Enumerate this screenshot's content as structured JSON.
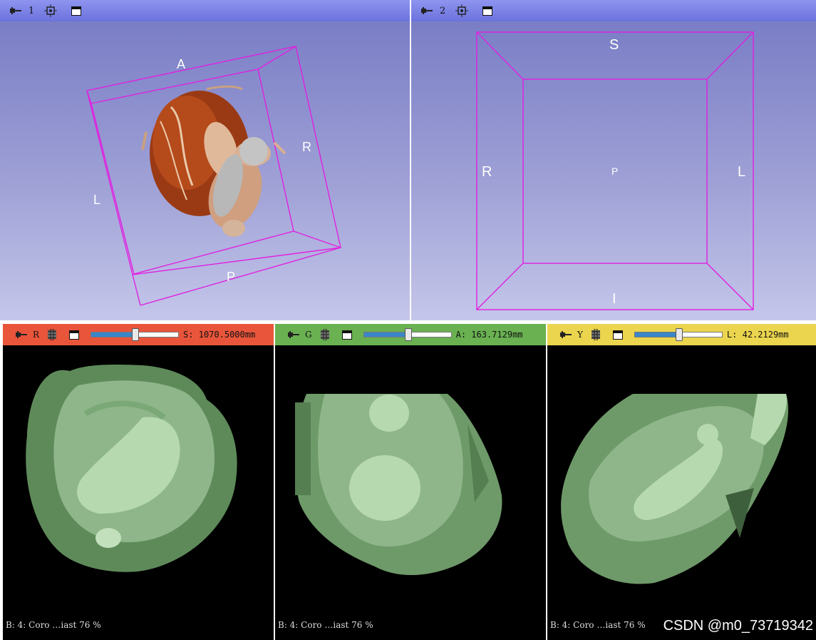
{
  "view1": {
    "number": "1",
    "orientation": {
      "A": "A",
      "R": "R",
      "L": "L",
      "P": "P"
    }
  },
  "view2": {
    "number": "2",
    "orientation": {
      "S": "S",
      "R": "R",
      "L": "L",
      "P": "P",
      "I": "I"
    }
  },
  "slices": [
    {
      "name": "R",
      "color": "#e9553b",
      "slider_fraction": 0.5,
      "value": "S: 1070.5000mm",
      "footer": "B: 4: Coro  …iast 76 %"
    },
    {
      "name": "G",
      "color": "#6ab151",
      "slider_fraction": 0.5,
      "value": "A: 163.7129mm",
      "footer": "B: 4: Coro  …iast 76 %"
    },
    {
      "name": "Y",
      "color": "#ebd54e",
      "slider_fraction": 0.5,
      "value": "L: 42.2129mm",
      "footer": "B: 4: Coro  …iast 76 %"
    }
  ],
  "watermark": "CSDN @m0_73719342",
  "icons": {
    "pin": "pin-icon",
    "center": "center-view-icon",
    "maximize": "maximize-icon",
    "fill": "slice-fill-icon"
  }
}
